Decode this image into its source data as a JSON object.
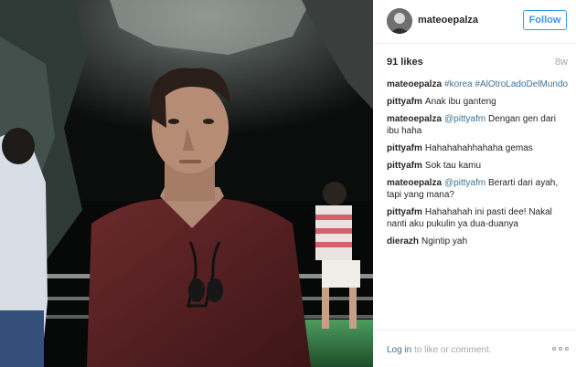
{
  "post": {
    "username": "mateoepalza",
    "follow_label": "Follow",
    "likes": "91 likes",
    "time": "8w"
  },
  "comments": [
    {
      "author": "mateoepalza",
      "parts": [
        {
          "text": "#korea",
          "link": true
        },
        {
          "text": " ",
          "link": false
        },
        {
          "text": "#AlOtroLadoDelMundo",
          "link": true
        }
      ]
    },
    {
      "author": "pittyafm",
      "parts": [
        {
          "text": "Anak ibu ganteng",
          "link": false
        }
      ]
    },
    {
      "author": "mateoepalza",
      "parts": [
        {
          "text": "@pittyafm",
          "link": true
        },
        {
          "text": " Dengan gen dari ibu haha",
          "link": false
        }
      ]
    },
    {
      "author": "pittyafm",
      "parts": [
        {
          "text": "Hahahahahhahaha gemas",
          "link": false
        }
      ]
    },
    {
      "author": "pittyafm",
      "parts": [
        {
          "text": "Sok tau kamu",
          "link": false
        }
      ]
    },
    {
      "author": "mateoepalza",
      "parts": [
        {
          "text": "@pittyafm",
          "link": true
        },
        {
          "text": " Berarti dari ayah, tapi yang mana?",
          "link": false
        }
      ]
    },
    {
      "author": "pittyafm",
      "parts": [
        {
          "text": "Hahahahah ini pasti dee! Nakal nanti aku pukulin ya dua-duanya",
          "link": false
        }
      ]
    },
    {
      "author": "dierazh",
      "parts": [
        {
          "text": "Ngintip yah",
          "link": false
        }
      ]
    }
  ],
  "footer": {
    "login_link": "Log in",
    "login_rest": " to like or comment."
  },
  "icons": {
    "more": "more-options-icon",
    "avatar": "avatar"
  },
  "colors": {
    "follow_blue": "#3897f0",
    "link_blue": "#3f729b",
    "muted_gray": "#a5a7aa"
  }
}
